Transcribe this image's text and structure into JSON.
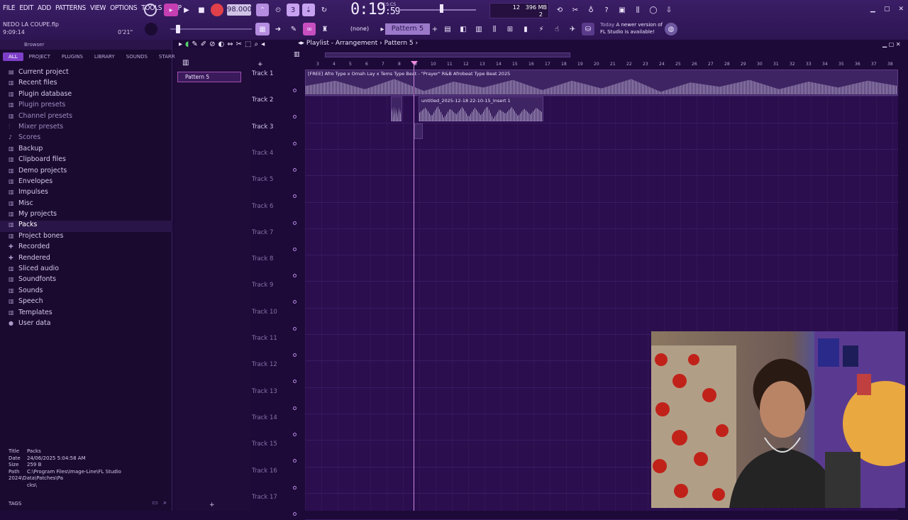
{
  "menu": [
    "FILE",
    "EDIT",
    "ADD",
    "PATTERNS",
    "VIEW",
    "OPTIONS",
    "TOOLS",
    "HELP"
  ],
  "project": {
    "name": "NEDO LA COUPE.flp",
    "time": "9:09:14",
    "length": "0'21\""
  },
  "transport": {
    "tempo": "98.000",
    "clock": "0:19",
    "clock_sub": "59",
    "clock_unit": "M:S:CS"
  },
  "cpu": {
    "voices": "12",
    "memory": "396 MB",
    "poly": "2"
  },
  "pattern_selector": {
    "none_label": "(none)",
    "pattern": "Pattern 5"
  },
  "news": {
    "date": "Today",
    "text1": "A newer version of",
    "text2": "FL Studio is available!"
  },
  "browser": {
    "title": "Browser",
    "tabs": [
      "ALL",
      "PROJECT",
      "PLUGINS",
      "LIBRARY",
      "SOUNDS",
      "STARRED"
    ],
    "items": [
      {
        "label": "Current project",
        "icon": "▤"
      },
      {
        "label": "Recent files",
        "icon": "▥"
      },
      {
        "label": "Plugin database",
        "icon": "▥"
      },
      {
        "label": "Plugin presets",
        "icon": "▥",
        "dim": true
      },
      {
        "label": "Channel presets",
        "icon": "▥",
        "dim": true
      },
      {
        "label": "Mixer presets",
        "icon": "⫶",
        "dim": true
      },
      {
        "label": "Scores",
        "icon": "♪",
        "dim": true
      },
      {
        "label": "Backup",
        "icon": "▥"
      },
      {
        "label": "Clipboard files",
        "icon": "▥"
      },
      {
        "label": "Demo projects",
        "icon": "▥"
      },
      {
        "label": "Envelopes",
        "icon": "▥"
      },
      {
        "label": "Impulses",
        "icon": "▥"
      },
      {
        "label": "Misc",
        "icon": "▥"
      },
      {
        "label": "My projects",
        "icon": "▥"
      },
      {
        "label": "Packs",
        "icon": "▥",
        "sel": true
      },
      {
        "label": "Project bones",
        "icon": "▥"
      },
      {
        "label": "Recorded",
        "icon": "✚"
      },
      {
        "label": "Rendered",
        "icon": "✚"
      },
      {
        "label": "Sliced audio",
        "icon": "▥"
      },
      {
        "label": "Soundfonts",
        "icon": "▥"
      },
      {
        "label": "Sounds",
        "icon": "▥"
      },
      {
        "label": "Speech",
        "icon": "▥"
      },
      {
        "label": "Templates",
        "icon": "▥"
      },
      {
        "label": "User data",
        "icon": "●"
      }
    ],
    "info": {
      "title_k": "Title",
      "title_v": "Packs",
      "date_k": "Date",
      "date_v": "24/06/2025 5:04:58 AM",
      "size_k": "Size",
      "size_v": "259 B",
      "path_k": "Path",
      "path_v": "C:\\Program Files\\Image-Line\\FL Studio 2024\\Data\\Patches\\Pa",
      "path_v2": "cks\\"
    },
    "tags": "TAGS"
  },
  "picker": {
    "pattern": "Pattern 5"
  },
  "playlist": {
    "title": "Playlist - Arrangement",
    "sep": "›",
    "pattern": "Pattern 5",
    "ruler": [
      "3",
      "4",
      "5",
      "6",
      "7",
      "8",
      "9",
      "10",
      "11",
      "12",
      "13",
      "14",
      "15",
      "16",
      "17",
      "18",
      "19",
      "20",
      "21",
      "22",
      "23",
      "24",
      "25",
      "26",
      "27",
      "28",
      "29",
      "30",
      "31",
      "32",
      "33",
      "34",
      "35",
      "36",
      "37",
      "38"
    ],
    "tracks": [
      "Track 1",
      "Track 2",
      "Track 3",
      "Track 4",
      "Track 5",
      "Track 6",
      "Track 7",
      "Track 8",
      "Track 9",
      "Track 10",
      "Track 11",
      "Track 12",
      "Track 13",
      "Track 14",
      "Track 15",
      "Track 16",
      "Track 17"
    ],
    "clip1": "[FREE] Afro Type x Omah Lay x Tems Type Beat - \"Prayer\" R&B Afrobeat Type Beat 2025",
    "clip2": "untitled_2025-12-18 22-10-15_Insert 1"
  }
}
